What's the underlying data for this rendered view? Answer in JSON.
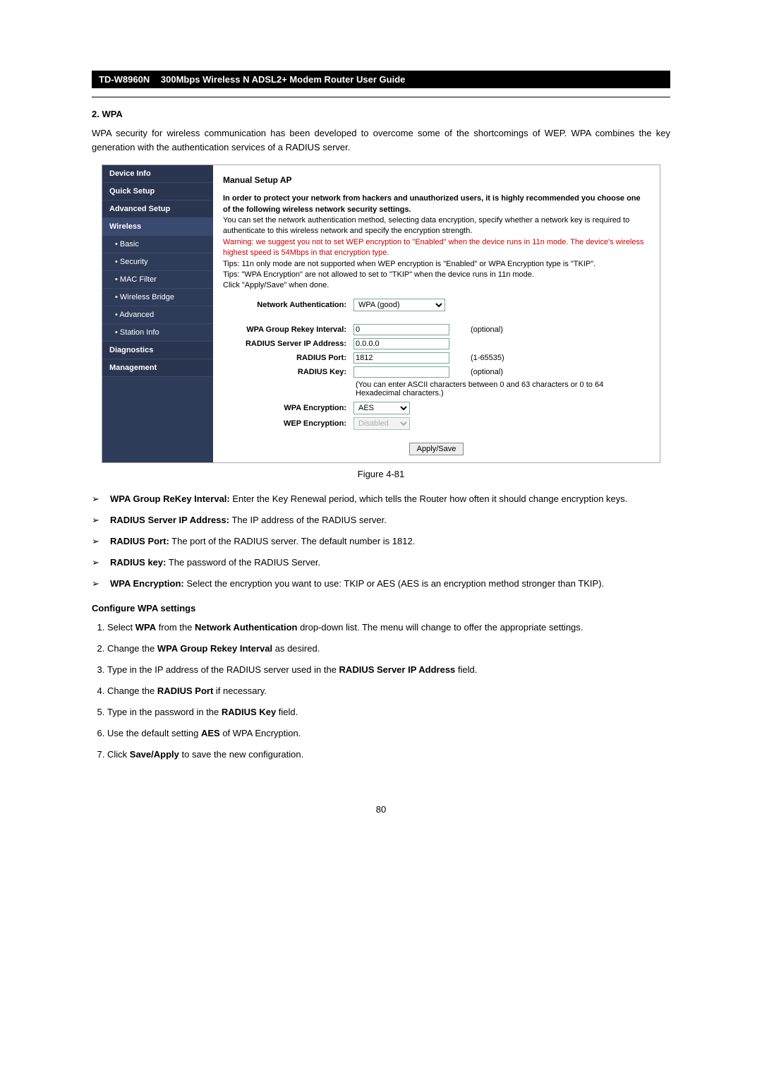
{
  "header": {
    "model": "TD-W8960N",
    "title": "300Mbps Wireless N ADSL2+ Modem Router User Guide"
  },
  "section": {
    "number_title": "2.    WPA",
    "intro": "WPA security for wireless communication has been developed to overcome some of the shortcomings of WEP. WPA combines the key generation with the authentication services of a RADIUS server."
  },
  "sidebar": {
    "items": [
      {
        "label": "Device Info",
        "type": "top"
      },
      {
        "label": "Quick Setup",
        "type": "top"
      },
      {
        "label": "Advanced Setup",
        "type": "top"
      },
      {
        "label": "Wireless",
        "type": "open"
      },
      {
        "label": "Basic",
        "type": "sub"
      },
      {
        "label": "Security",
        "type": "sub"
      },
      {
        "label": "MAC Filter",
        "type": "sub"
      },
      {
        "label": "Wireless Bridge",
        "type": "sub"
      },
      {
        "label": "Advanced",
        "type": "sub"
      },
      {
        "label": "Station Info",
        "type": "sub"
      },
      {
        "label": "Diagnostics",
        "type": "top"
      },
      {
        "label": "Management",
        "type": "top"
      }
    ]
  },
  "panel": {
    "title": "Manual Setup AP",
    "p1": "In order to protect your network from hackers and unauthorized users, it is highly recommended you choose one of the following wireless network security settings.",
    "p2": "You can set the network authentication method, selecting data encryption, specify whether a network key is required to authenticate to this wireless network and specify the encryption strength.",
    "warn": "Warning: we suggest you not to set WEP encryption to \"Enabled\" when the device runs in 11n mode. The device's wireless highest speed is 54Mbps in that encryption type.",
    "tips1": "Tips: 11n only mode are not supported when WEP encryption is \"Enabled\" or WPA Encryption type is \"TKIP\".",
    "tips2": "Tips: \"WPA Encryption\" are not allowed to set to \"TKIP\" when the device runs in 11n mode.",
    "click": "Click \"Apply/Save\" when done.",
    "form": {
      "net_auth_label": "Network Authentication:",
      "net_auth_value": "WPA (good)",
      "rekey_label": "WPA Group Rekey Interval:",
      "rekey_value": "0",
      "rekey_suffix": "(optional)",
      "radius_ip_label": "RADIUS Server IP Address:",
      "radius_ip_value": "0.0.0.0",
      "radius_port_label": "RADIUS Port:",
      "radius_port_value": "1812",
      "radius_port_suffix": "(1-65535)",
      "radius_key_label": "RADIUS Key:",
      "radius_key_value": "",
      "radius_key_suffix": "(optional)",
      "radius_key_hint": "(You can enter ASCII characters between 0 and 63 characters or 0 to 64 Hexadecimal characters.)",
      "wpa_enc_label": "WPA Encryption:",
      "wpa_enc_value": "AES",
      "wep_enc_label": "WEP Encryption:",
      "wep_enc_value": "Disabled"
    },
    "apply_button": "Apply/Save"
  },
  "figure_caption": "Figure 4-81",
  "bullets": [
    {
      "bold": "WPA Group ReKey Interval:",
      "text": " Enter the Key Renewal period, which tells the Router how often it should change encryption keys."
    },
    {
      "bold": "RADIUS Server IP Address:",
      "text": " The IP address of the RADIUS server."
    },
    {
      "bold": "RADIUS Port:",
      "text": " The port of the RADIUS server. The default number is 1812."
    },
    {
      "bold": "RADIUS key:",
      "text": " The password of the RADIUS Server."
    },
    {
      "bold": "WPA Encryption:",
      "text": " Select the encryption you want to use: TKIP or AES (AES is an encryption method stronger than TKIP)."
    }
  ],
  "configure_heading": "Configure WPA settings",
  "steps": [
    {
      "pre": "Select ",
      "b1": "WPA",
      "mid": " from the ",
      "b2": "Network Authentication",
      "post": " drop-down list. The menu will change to offer the appropriate settings."
    },
    {
      "pre": "Change the ",
      "b1": "WPA Group Rekey Interval",
      "mid": "",
      "b2": "",
      "post": " as desired."
    },
    {
      "pre": "Type in the IP address of the RADIUS server used in the ",
      "b1": "RADIUS Server IP Address",
      "mid": "",
      "b2": "",
      "post": " field."
    },
    {
      "pre": "Change the ",
      "b1": "RADIUS Port",
      "mid": "",
      "b2": "",
      "post": " if necessary."
    },
    {
      "pre": "Type in the password in the ",
      "b1": "RADIUS Key",
      "mid": "",
      "b2": "",
      "post": " field."
    },
    {
      "pre": "Use the default setting ",
      "b1": "AES",
      "mid": "",
      "b2": "",
      "post": " of WPA Encryption."
    },
    {
      "pre": "Click ",
      "b1": "Save/Apply",
      "mid": "",
      "b2": "",
      "post": " to save the new configuration."
    }
  ],
  "pagenum": "80"
}
